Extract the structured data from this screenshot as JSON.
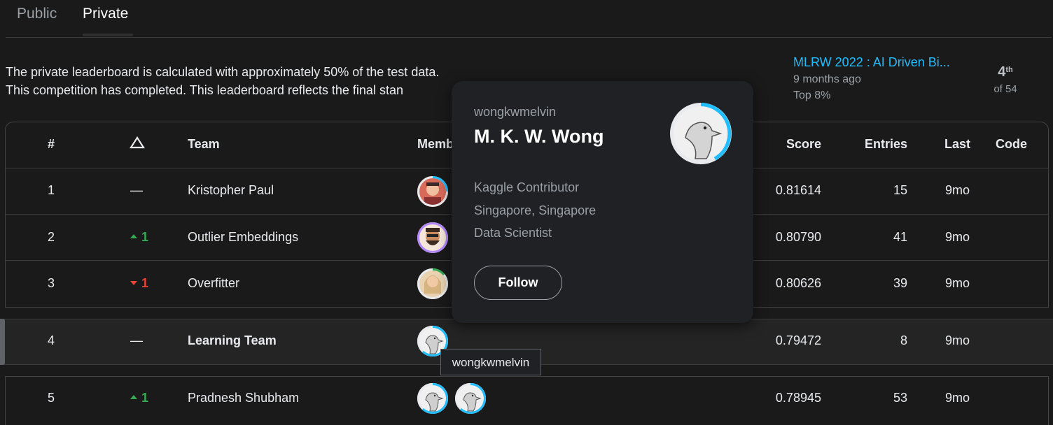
{
  "tabs": [
    {
      "label": "Public"
    },
    {
      "label": "Private"
    }
  ],
  "info": {
    "line1": "The private leaderboard is calculated with approximately 50% of the test data.",
    "line2": "This competition has completed. This leaderboard reflects the final stan"
  },
  "competition": {
    "title": "MLRW 2022 : AI Driven Bi...",
    "time": "9 months ago",
    "top": "Top 8%",
    "rank": "4",
    "rank_suffix": "th",
    "of": "of 54"
  },
  "table": {
    "headers": {
      "rank": "#",
      "change_icon": "delta-icon",
      "team": "Team",
      "members": "Memb",
      "score": "Score",
      "entries": "Entries",
      "last": "Last",
      "code": "Code"
    },
    "rows": [
      {
        "rank": "1",
        "change": "—",
        "team": "Kristopher Paul",
        "score": "0.81614",
        "entries": "15",
        "last": "9mo"
      },
      {
        "rank": "2",
        "change": "1",
        "team": "Outlier Embeddings",
        "score": "0.80790",
        "entries": "41",
        "last": "9mo"
      },
      {
        "rank": "3",
        "change": "1",
        "team": "Overfitter",
        "score": "0.80626",
        "entries": "39",
        "last": "9mo"
      },
      {
        "rank": "4",
        "change": "—",
        "team": "Learning Team",
        "score": "0.79472",
        "entries": "8",
        "last": "9mo"
      },
      {
        "rank": "5",
        "change": "1",
        "team": "Pradnesh Shubham",
        "score": "0.78945",
        "entries": "53",
        "last": "9mo"
      }
    ]
  },
  "popover": {
    "username": "wongkwmelvin",
    "name": "M. K. W. Wong",
    "tier": "Kaggle Contributor",
    "location": "Singapore, Singapore",
    "occupation": "Data Scientist",
    "follow_label": "Follow"
  },
  "tooltip": {
    "text": "wongkwmelvin"
  },
  "colors": {
    "background": "#1a1a1a",
    "link": "#20beff",
    "up": "#34a853",
    "down": "#ea4335",
    "ring": "#20beff"
  }
}
